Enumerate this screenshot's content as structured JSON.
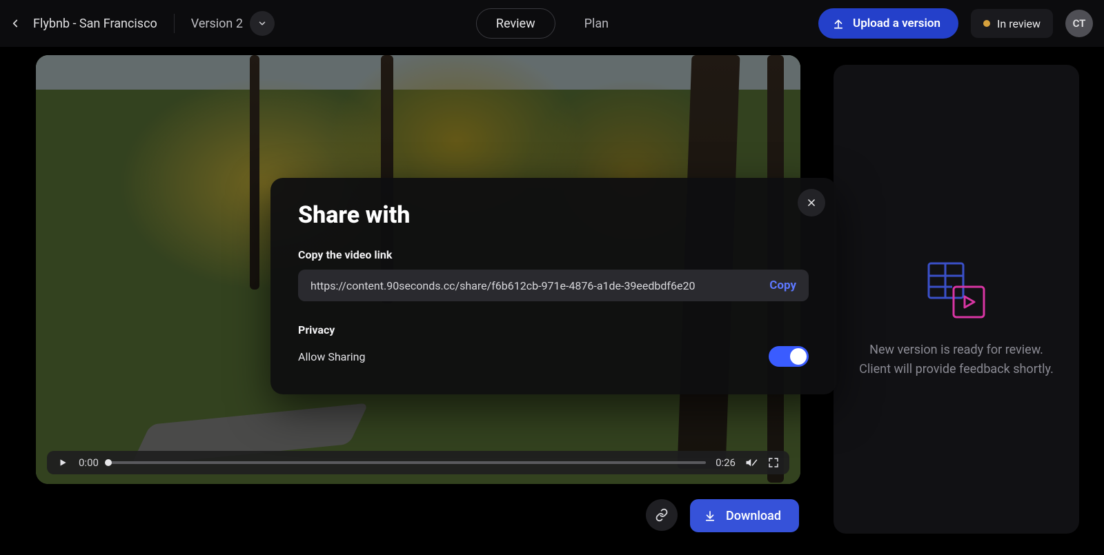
{
  "header": {
    "project_title": "Flybnb - San Francisco",
    "version_label": "Version 2",
    "tabs": {
      "review": "Review",
      "plan": "Plan"
    },
    "upload_label": "Upload a version",
    "status_text": "In review",
    "avatar_initials": "CT"
  },
  "video": {
    "time_current": "0:00",
    "time_total": "0:26"
  },
  "actions": {
    "download_label": "Download"
  },
  "sidebar": {
    "message_line1": "New version is ready for review.",
    "message_line2": "Client will provide feedback shortly."
  },
  "modal": {
    "title": "Share with",
    "copy_label": "Copy the video link",
    "url": "https://content.90seconds.cc/share/f6b612cb-971e-4876-a1de-39eedbdf6e20",
    "copy_button": "Copy",
    "privacy_heading": "Privacy",
    "allow_sharing_label": "Allow Sharing",
    "allow_sharing_on": true
  }
}
